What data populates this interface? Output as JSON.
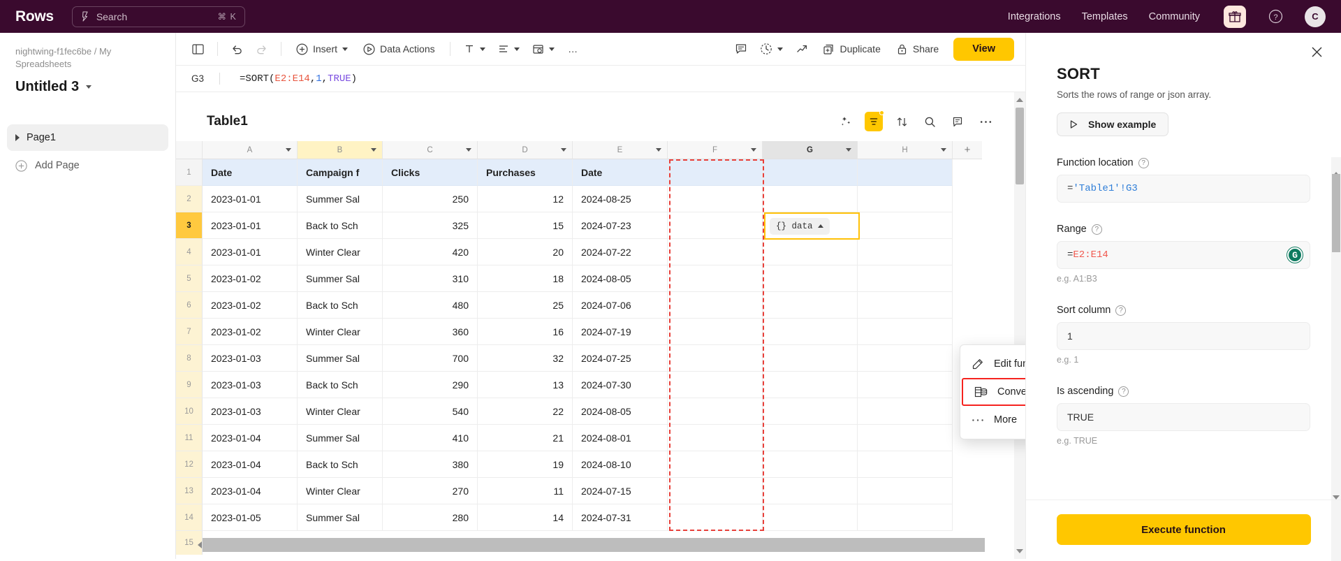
{
  "topbar": {
    "brand": "Rows",
    "search_placeholder": "Search",
    "search_shortcut": "⌘ K",
    "nav": [
      {
        "label": "Integrations"
      },
      {
        "label": "Templates"
      },
      {
        "label": "Community"
      }
    ],
    "gift_icon": "gift-icon",
    "help_icon": "help-circle-icon",
    "avatar_initial": "C"
  },
  "sidebar": {
    "breadcrumb": "nightwing-f1fec6be / My Spreadsheets",
    "doc_title": "Untitled 3",
    "pages": [
      {
        "label": "Page1"
      }
    ],
    "add_page_label": "Add Page"
  },
  "toolbar": {
    "panel_toggle": "panel-toggle-icon",
    "undo": "undo-icon",
    "redo": "redo-icon",
    "insert_label": "Insert",
    "data_actions_label": "Data Actions",
    "text_format": "text-format-icon",
    "align": "align-icon",
    "cell_style": "cell-style-icon",
    "more_label": "…",
    "comment": "comment-icon",
    "history": "history-icon",
    "chart": "trend-chart-icon",
    "duplicate_label": "Duplicate",
    "share_label": "Share",
    "view_label": "View"
  },
  "formula_bar": {
    "cell_ref": "G3",
    "formula_prefix": "=SORT(",
    "formula_range": "E2:E14",
    "formula_comma1": ",",
    "formula_num": "1",
    "formula_comma2": ",",
    "formula_bool": "TRUE",
    "formula_suffix": ")"
  },
  "sheet": {
    "table_name": "Table1",
    "icons": [
      {
        "name": "magic-wand-icon"
      },
      {
        "name": "filter-icon"
      },
      {
        "name": "sort-icon"
      },
      {
        "name": "search-icon"
      },
      {
        "name": "notes-icon"
      },
      {
        "name": "more-icon"
      }
    ],
    "columns": [
      "A",
      "B",
      "C",
      "D",
      "E",
      "F",
      "G",
      "H"
    ],
    "add_column_label": "+",
    "header_row_number": "1",
    "headers": [
      "Date",
      "Campaign f",
      "Clicks",
      "Purchases",
      "Date",
      "",
      "",
      ""
    ],
    "rows": [
      {
        "n": "2",
        "cells": [
          "2023-01-01",
          "Summer Sal",
          "250",
          "12",
          "2024-08-25",
          "",
          "",
          ""
        ]
      },
      {
        "n": "3",
        "cells": [
          "2023-01-01",
          "Back to Sch",
          "325",
          "15",
          "2024-07-23",
          "",
          "",
          ""
        ]
      },
      {
        "n": "4",
        "cells": [
          "2023-01-01",
          "Winter Clear",
          "420",
          "20",
          "2024-07-22",
          "",
          "",
          ""
        ]
      },
      {
        "n": "5",
        "cells": [
          "2023-01-02",
          "Summer Sal",
          "310",
          "18",
          "2024-08-05",
          "",
          "",
          ""
        ]
      },
      {
        "n": "6",
        "cells": [
          "2023-01-02",
          "Back to Sch",
          "480",
          "25",
          "2024-07-06",
          "",
          "",
          ""
        ]
      },
      {
        "n": "7",
        "cells": [
          "2023-01-02",
          "Winter Clear",
          "360",
          "16",
          "2024-07-19",
          "",
          "",
          ""
        ]
      },
      {
        "n": "8",
        "cells": [
          "2023-01-03",
          "Summer Sal",
          "700",
          "32",
          "2024-07-25",
          "",
          "",
          ""
        ]
      },
      {
        "n": "9",
        "cells": [
          "2023-01-03",
          "Back to Sch",
          "290",
          "13",
          "2024-07-30",
          "",
          "",
          ""
        ]
      },
      {
        "n": "10",
        "cells": [
          "2023-01-03",
          "Winter Clear",
          "540",
          "22",
          "2024-08-05",
          "",
          "",
          ""
        ]
      },
      {
        "n": "11",
        "cells": [
          "2023-01-04",
          "Summer Sal",
          "410",
          "21",
          "2024-08-01",
          "",
          "",
          ""
        ]
      },
      {
        "n": "12",
        "cells": [
          "2023-01-04",
          "Back to Sch",
          "380",
          "19",
          "2024-08-10",
          "",
          "",
          ""
        ]
      },
      {
        "n": "13",
        "cells": [
          "2023-01-04",
          "Winter Clear",
          "270",
          "11",
          "2024-07-15",
          "",
          "",
          ""
        ]
      },
      {
        "n": "14",
        "cells": [
          "2023-01-05",
          "Summer Sal",
          "280",
          "14",
          "2024-07-31",
          "",
          "",
          ""
        ]
      }
    ],
    "last_row_number": "15",
    "selected_cell_chip": "{} data",
    "selected_column": "G",
    "current_row": "3"
  },
  "context_menu": {
    "items": [
      {
        "label": "Edit function",
        "icon": "edit-pencil-icon",
        "highlight": false,
        "submenu": false
      },
      {
        "label": "Convert to Data Table",
        "icon": "data-table-icon",
        "highlight": true,
        "submenu": false
      },
      {
        "label": "More",
        "icon": "more-dots-icon",
        "highlight": false,
        "submenu": true
      }
    ]
  },
  "right_panel": {
    "close_icon": "close-icon",
    "title": "SORT",
    "description": "Sorts the rows of range or json array.",
    "show_example_label": "Show example",
    "fields": [
      {
        "label": "Function location",
        "prefix": "=",
        "value": "'Table1'!G3",
        "value_color": "blue",
        "hint": "",
        "grammarly": false
      },
      {
        "label": "Range",
        "prefix": "=",
        "value": "E2:E14",
        "value_color": "red",
        "hint": "e.g. A1:B3",
        "grammarly": true
      },
      {
        "label": "Sort column",
        "prefix": "",
        "value": "1",
        "value_color": "plain",
        "hint": "e.g. 1",
        "grammarly": false
      },
      {
        "label": "Is ascending",
        "prefix": "",
        "value": "TRUE",
        "value_color": "plain",
        "hint": "e.g. TRUE",
        "grammarly": false
      }
    ],
    "execute_label": "Execute function"
  },
  "colors": {
    "brand_purple": "#3A0A2E",
    "accent_yellow": "#FFC700",
    "range_red": "#E8403A",
    "highlight_red": "#F5231F",
    "header_blue": "#E3EDFA"
  }
}
